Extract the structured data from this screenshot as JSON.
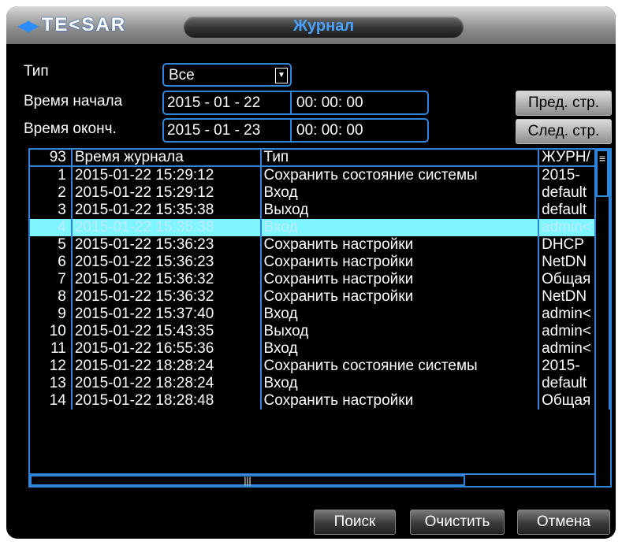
{
  "window": {
    "logo_text": "TE<SAR",
    "logo_arrows": "◀▶",
    "title": "Журнал"
  },
  "filters": {
    "type_label": "Тип",
    "type_value": "Все",
    "start_label": "Время начала",
    "start_date": "2015 - 01 - 22",
    "start_time": "00: 00: 00",
    "end_label": "Время оконч.",
    "end_date": "2015 - 01 - 23",
    "end_time": "00: 00: 00"
  },
  "nav": {
    "prev_page": "Пред. стр.",
    "next_page": "След. стр."
  },
  "table": {
    "headers": [
      "93",
      "Время журнала",
      "Тип",
      "ЖУРН/"
    ],
    "rows": [
      [
        "1",
        "2015-01-22 15:29:12",
        "Сохранить состояние системы",
        "2015-"
      ],
      [
        "2",
        "2015-01-22 15:29:12",
        "Вход",
        "default"
      ],
      [
        "3",
        "2015-01-22 15:35:38",
        "Выход",
        "default"
      ],
      [
        "4",
        "2015-01-22 15:35:38",
        "Вход",
        "admin<"
      ],
      [
        "5",
        "2015-01-22 15:36:23",
        "Сохранить настройки",
        "DHCP"
      ],
      [
        "6",
        "2015-01-22 15:36:23",
        "Сохранить настройки",
        "NetDN"
      ],
      [
        "7",
        "2015-01-22 15:36:32",
        "Сохранить настройки",
        "Общая"
      ],
      [
        "8",
        "2015-01-22 15:36:32",
        "Сохранить настройки",
        "NetDN"
      ],
      [
        "9",
        "2015-01-22 15:37:40",
        "Вход",
        "admin<"
      ],
      [
        "10",
        "2015-01-22 15:43:35",
        "Выход",
        "admin<"
      ],
      [
        "11",
        "2015-01-22 16:55:36",
        "Вход",
        "admin<"
      ],
      [
        "12",
        "2015-01-22 18:28:24",
        "Сохранить состояние системы",
        "2015-"
      ],
      [
        "13",
        "2015-01-22 18:28:24",
        "Вход",
        "default"
      ],
      [
        "14",
        "2015-01-22 18:28:48",
        "Сохранить настройки",
        "Общая"
      ]
    ],
    "selected_row": 4
  },
  "buttons": {
    "search": "Поиск",
    "clear": "Очистить",
    "cancel": "Отмена"
  },
  "colors": {
    "accent": "#2f86d8",
    "selected_row": "#7ff6ff",
    "background": "#000000"
  }
}
